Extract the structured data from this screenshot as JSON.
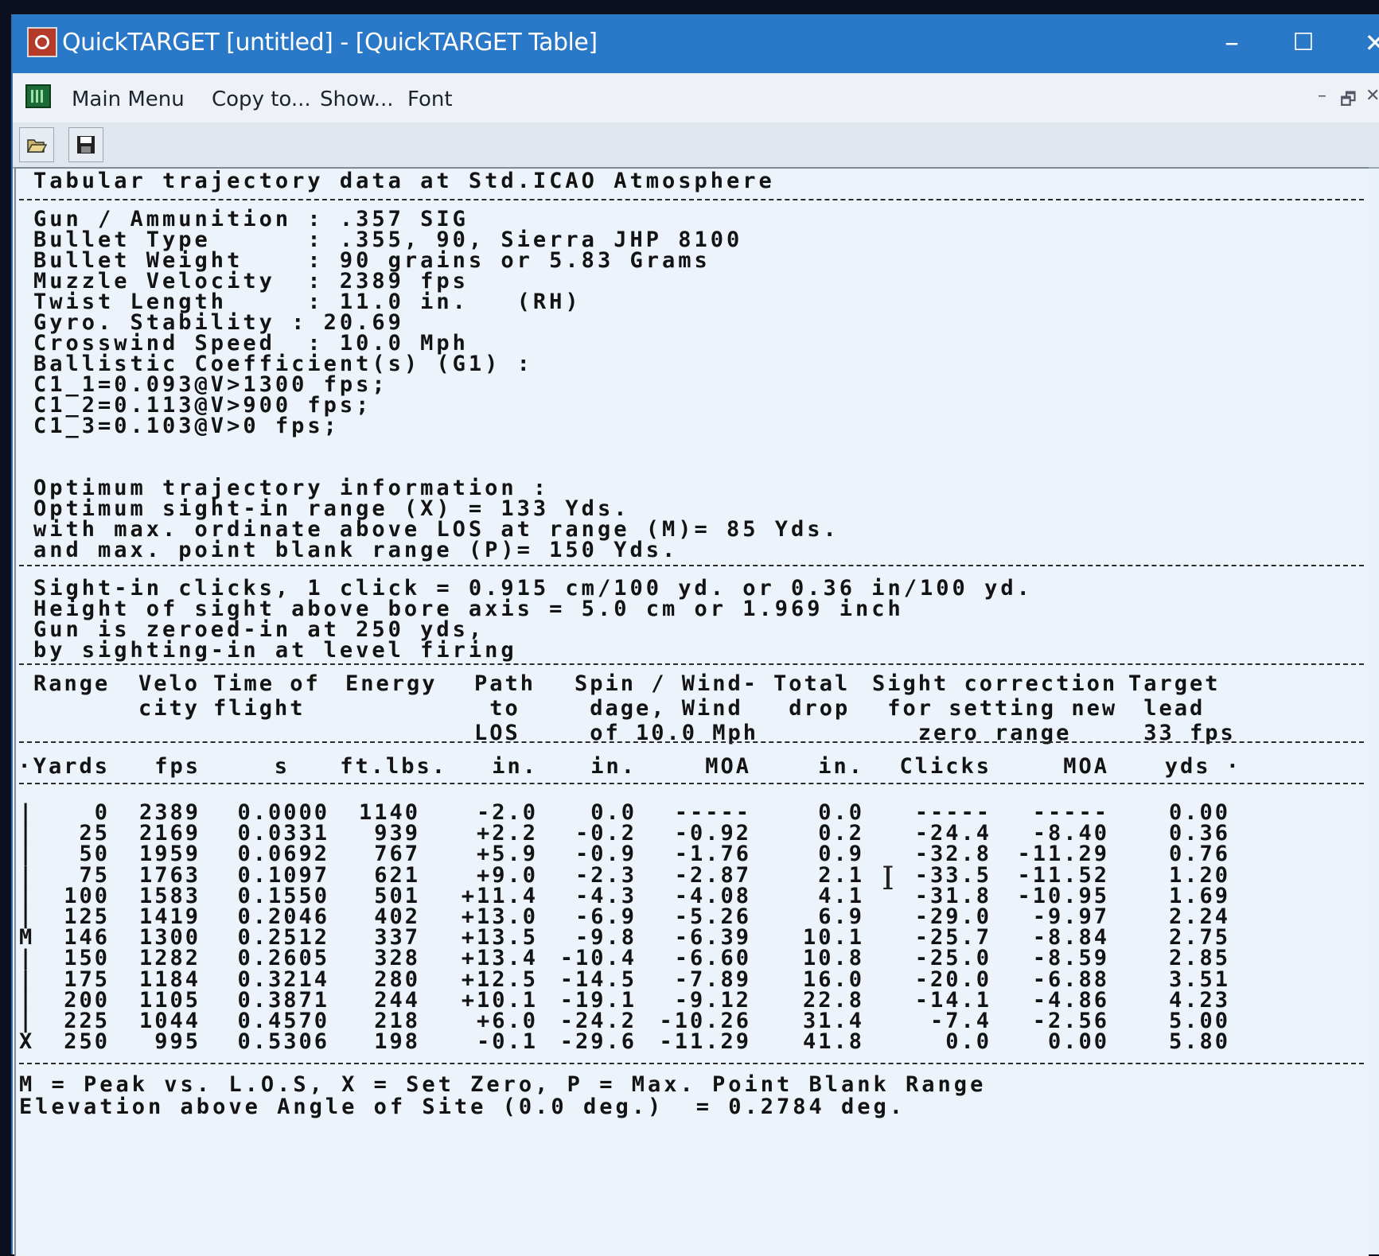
{
  "window": {
    "title": "QuickTARGET   [untitled] - [QuickTARGET Table]",
    "minimize": "–",
    "maximize": "☐",
    "close": "✕"
  },
  "menu": {
    "items": [
      "Main Menu",
      "Copy to...",
      "Show...",
      "Font"
    ],
    "mdi_min": "–",
    "mdi_restore": "🗗",
    "mdi_close": "✕"
  },
  "toolbar": {
    "open_icon": "folder-open-icon",
    "save_icon": "floppy-disk-icon"
  },
  "report": {
    "heading": "Tabular trajectory data at Std.ICAO Atmosphere",
    "info_lines": [
      "Gun / Ammunition : .357 SIG",
      "Bullet Type      : .355, 90, Sierra JHP 8100",
      "Bullet Weight    : 90 grains or 5.83 Grams",
      "Muzzle Velocity  : 2389 fps",
      "Twist Length     : 11.0 in.   (RH)",
      "Gyro. Stability : 20.69",
      "Crosswind Speed  : 10.0 Mph",
      "Ballistic Coefficient(s) (G1) :",
      "C1_1=0.093@V>1300 fps;",
      "C1_2=0.113@V>900 fps;",
      "C1_3=0.103@V>0 fps;"
    ],
    "optimum_lines": [
      "Optimum trajectory information :",
      "Optimum sight-in range (X) = 133 Yds.",
      "with max. ordinate above LOS at range (M)= 85 Yds.",
      "and max. point blank range (P)= 150 Yds."
    ],
    "sight_lines": [
      "Sight-in clicks, 1 click = 0.915 cm/100 yd. or 0.36 in/100 yd.",
      "Height of sight above bore axis = 5.0 cm or 1.969 inch",
      "Gun is zeroed-in at 250 yds,",
      "by sighting-in at level firing"
    ],
    "column_headers": {
      "range": "Range",
      "velocity": "Velo\ncity",
      "time": "Time of\nflight",
      "energy": "Energy",
      "path": "Path\n to\nLOS",
      "spin": "Spin / Wind-\n dage, Wind\n of 10.0 Mph",
      "drop": "Total\n drop",
      "sight": "Sight correction\n for setting new\n   zero range",
      "lead": "Target\n lead\n 33 fps"
    },
    "units": [
      "·Yards",
      "fps",
      "s",
      "ft.lbs.",
      "in.",
      "in.",
      "MOA",
      "in.",
      "Clicks",
      "MOA",
      "yds ·"
    ],
    "rows": [
      {
        "mark": "|",
        "range": "0",
        "vel": "2389",
        "time": "0.0000",
        "energy": "1140",
        "path": "-2.0",
        "spin": "0.0",
        "moa": "-----",
        "drop": "0.0",
        "clicks": "-----",
        "smoa": "-----",
        "lead": "0.00"
      },
      {
        "mark": "|",
        "range": "25",
        "vel": "2169",
        "time": "0.0331",
        "energy": "939",
        "path": "+2.2",
        "spin": "-0.2",
        "moa": "-0.92",
        "drop": "0.2",
        "clicks": "-24.4",
        "smoa": "-8.40",
        "lead": "0.36"
      },
      {
        "mark": "|",
        "range": "50",
        "vel": "1959",
        "time": "0.0692",
        "energy": "767",
        "path": "+5.9",
        "spin": "-0.9",
        "moa": "-1.76",
        "drop": "0.9",
        "clicks": "-32.8",
        "smoa": "-11.29",
        "lead": "0.76"
      },
      {
        "mark": "|",
        "range": "75",
        "vel": "1763",
        "time": "0.1097",
        "energy": "621",
        "path": "+9.0",
        "spin": "-2.3",
        "moa": "-2.87",
        "drop": "2.1",
        "clicks": "-33.5",
        "smoa": "-11.52",
        "lead": "1.20"
      },
      {
        "mark": "|",
        "range": "100",
        "vel": "1583",
        "time": "0.1550",
        "energy": "501",
        "path": "+11.4",
        "spin": "-4.3",
        "moa": "-4.08",
        "drop": "4.1",
        "clicks": "-31.8",
        "smoa": "-10.95",
        "lead": "1.69"
      },
      {
        "mark": "|",
        "range": "125",
        "vel": "1419",
        "time": "0.2046",
        "energy": "402",
        "path": "+13.0",
        "spin": "-6.9",
        "moa": "-5.26",
        "drop": "6.9",
        "clicks": "-29.0",
        "smoa": "-9.97",
        "lead": "2.24"
      },
      {
        "mark": "M",
        "range": "146",
        "vel": "1300",
        "time": "0.2512",
        "energy": "337",
        "path": "+13.5",
        "spin": "-9.8",
        "moa": "-6.39",
        "drop": "10.1",
        "clicks": "-25.7",
        "smoa": "-8.84",
        "lead": "2.75"
      },
      {
        "mark": "|",
        "range": "150",
        "vel": "1282",
        "time": "0.2605",
        "energy": "328",
        "path": "+13.4",
        "spin": "-10.4",
        "moa": "-6.60",
        "drop": "10.8",
        "clicks": "-25.0",
        "smoa": "-8.59",
        "lead": "2.85"
      },
      {
        "mark": "|",
        "range": "175",
        "vel": "1184",
        "time": "0.3214",
        "energy": "280",
        "path": "+12.5",
        "spin": "-14.5",
        "moa": "-7.89",
        "drop": "16.0",
        "clicks": "-20.0",
        "smoa": "-6.88",
        "lead": "3.51"
      },
      {
        "mark": "|",
        "range": "200",
        "vel": "1105",
        "time": "0.3871",
        "energy": "244",
        "path": "+10.1",
        "spin": "-19.1",
        "moa": "-9.12",
        "drop": "22.8",
        "clicks": "-14.1",
        "smoa": "-4.86",
        "lead": "4.23"
      },
      {
        "mark": "|",
        "range": "225",
        "vel": "1044",
        "time": "0.4570",
        "energy": "218",
        "path": "+6.0",
        "spin": "-24.2",
        "moa": "-10.26",
        "drop": "31.4",
        "clicks": "-7.4",
        "smoa": "-2.56",
        "lead": "5.00"
      },
      {
        "mark": "X",
        "range": "250",
        "vel": "995",
        "time": "0.5306",
        "energy": "198",
        "path": "-0.1",
        "spin": "-29.6",
        "moa": "-11.29",
        "drop": "41.8",
        "clicks": "0.0",
        "smoa": "0.00",
        "lead": "5.80"
      }
    ],
    "footer_lines": [
      "M = Peak vs. L.O.S, X = Set Zero, P = Max. Point Blank Range",
      "Elevation above Angle of Site (0.0 deg.)  = 0.2784 deg."
    ],
    "cursor": "I"
  }
}
